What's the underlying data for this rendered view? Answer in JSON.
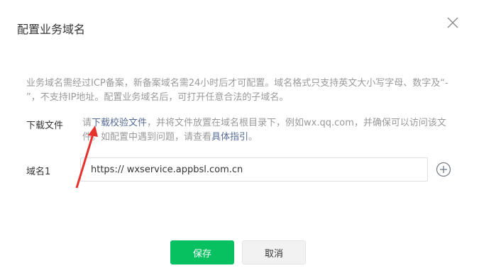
{
  "dialog": {
    "title": "配置业务域名",
    "description": "业务域名需经过ICP备案，新备案域名需24小时后才可配置。域名格式只支持英文大小写字母、数字及“- ”，不支持IP地址。配置业务域名后，可打开任意合法的子域名。"
  },
  "download": {
    "label": "下载文件",
    "text_prefix": "请",
    "link_download": "下载校验文件",
    "text_middle": "，并将文件放置在域名根目录下，例如wx.qq.com，并确保可以访问该文件。如配置中遇到问题，请查看",
    "link_guide": "具体指引",
    "text_suffix": "。"
  },
  "domain": {
    "label": "域名1",
    "value": "https:// wxservice.appbsl.com.cn"
  },
  "buttons": {
    "save": "保存",
    "cancel": "取消"
  },
  "colors": {
    "accent": "#07c160",
    "link": "#576b95",
    "annotation_arrow": "#e5322d"
  }
}
